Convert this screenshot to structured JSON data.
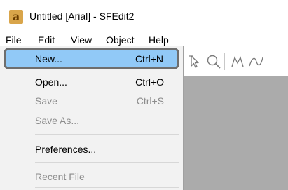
{
  "window": {
    "title": "Untitled [Arial] - SFEdit2",
    "app_icon_glyph": "a"
  },
  "menubar": {
    "items": [
      "File",
      "Edit",
      "View",
      "Object",
      "Help"
    ]
  },
  "file_menu": {
    "items": [
      {
        "label": "New...",
        "shortcut": "Ctrl+N",
        "enabled": true,
        "highlighted": true
      },
      {
        "label": "Open...",
        "shortcut": "Ctrl+O",
        "enabled": true
      },
      {
        "label": "Save",
        "shortcut": "Ctrl+S",
        "enabled": false
      },
      {
        "label": "Save As...",
        "shortcut": "",
        "enabled": false
      },
      {
        "label": "Preferences...",
        "shortcut": "",
        "enabled": true
      },
      {
        "label": "Recent File",
        "shortcut": "",
        "enabled": false
      }
    ]
  },
  "toolbar": {
    "icons": [
      "pointer-icon",
      "zoom-icon",
      "polyline-icon",
      "curve-icon"
    ]
  },
  "colors": {
    "highlight": "#91c9f7",
    "highlight_border": "#6e6e6e",
    "menu_bg": "#f2f2f2",
    "canvas_bg": "#ababab",
    "app_icon": "#d9a54a"
  }
}
